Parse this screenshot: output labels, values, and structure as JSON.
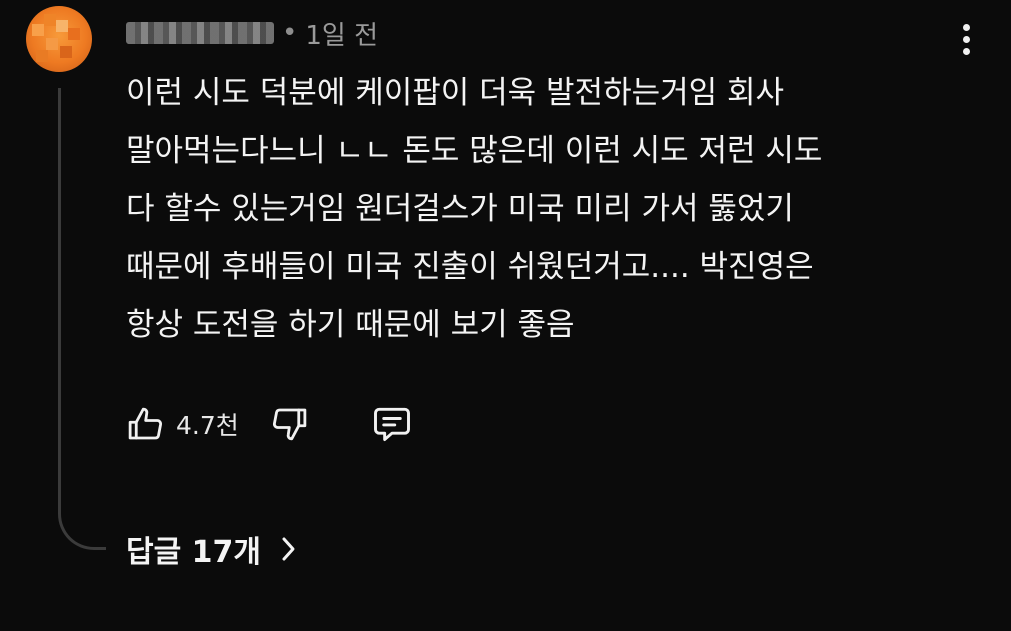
{
  "comment": {
    "time_ago": "1일 전",
    "meta_separator": "•",
    "lines": [
      "이런 시도 덕분에 케이팝이 더욱 발전하는거임 회사",
      "말아먹는다느니 ㄴㄴ 돈도 많은데 이런 시도 저런 시도",
      "다 할수 있는거임 원더걸스가 미국 미리 가서 뚫었기",
      "때문에 후배들이 미국 진출이 쉬웠던거고.... 박진영은",
      "항상 도전을 하기 때문에 보기 좋음"
    ],
    "like_count": "4.7천"
  },
  "replies": {
    "label": "답글 17개"
  },
  "icons": {
    "like": "thumbs-up-icon",
    "dislike": "thumbs-down-icon",
    "reply": "comment-icon",
    "more": "more-vertical-icon",
    "expand": "chevron-right-icon"
  },
  "colors": {
    "background": "#0b0b0b",
    "text": "#f1f1f1",
    "secondary_text": "#9a9a9a",
    "avatar": "#ee7a22",
    "thread_line": "#3b3b3b"
  }
}
